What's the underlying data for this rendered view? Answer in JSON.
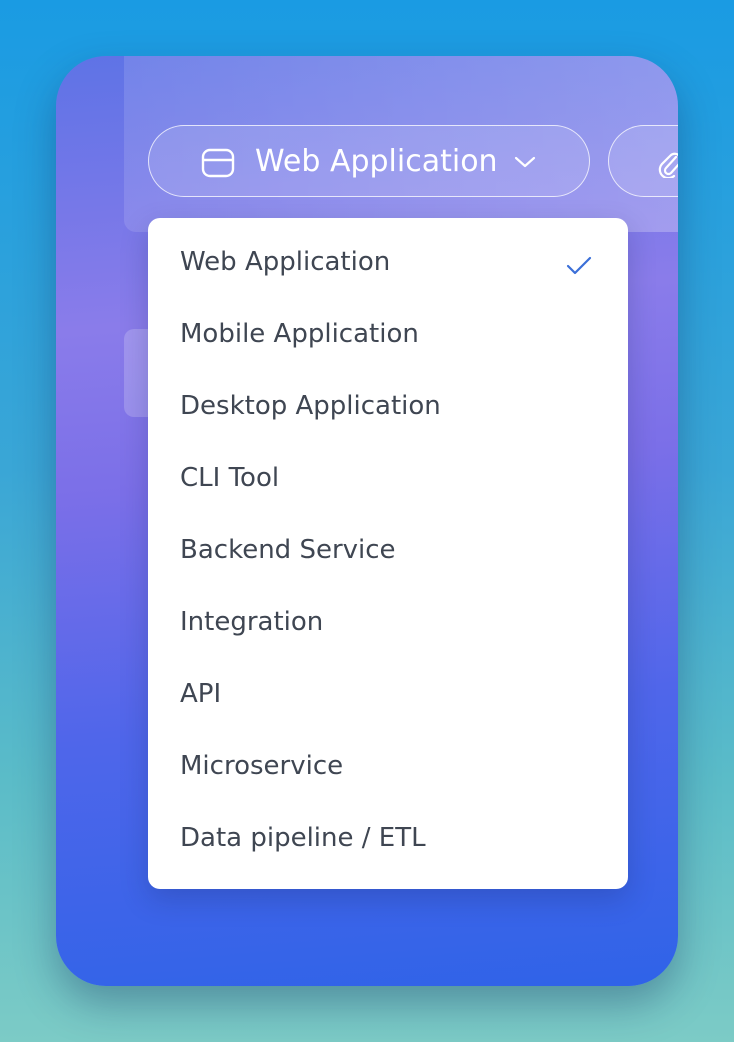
{
  "selector": {
    "selected_label": "Web Application",
    "icon": "database-icon",
    "chevron_icon": "chevron-down-icon"
  },
  "attach": {
    "icon": "paperclip-icon"
  },
  "dropdown": {
    "selected_index": 0,
    "check_icon": "checkmark-icon",
    "check_color": "#3b6fd8",
    "items": [
      {
        "label": "Web Application"
      },
      {
        "label": "Mobile Application"
      },
      {
        "label": "Desktop Application"
      },
      {
        "label": "CLI Tool"
      },
      {
        "label": "Backend Service"
      },
      {
        "label": "Integration"
      },
      {
        "label": "API"
      },
      {
        "label": "Microservice"
      },
      {
        "label": "Data pipeline / ETL"
      }
    ]
  },
  "colors": {
    "background_top": "#1a9be3",
    "background_bottom": "#7ccbc6",
    "window_accent": "#2f63e8",
    "item_text": "#3f4652"
  }
}
